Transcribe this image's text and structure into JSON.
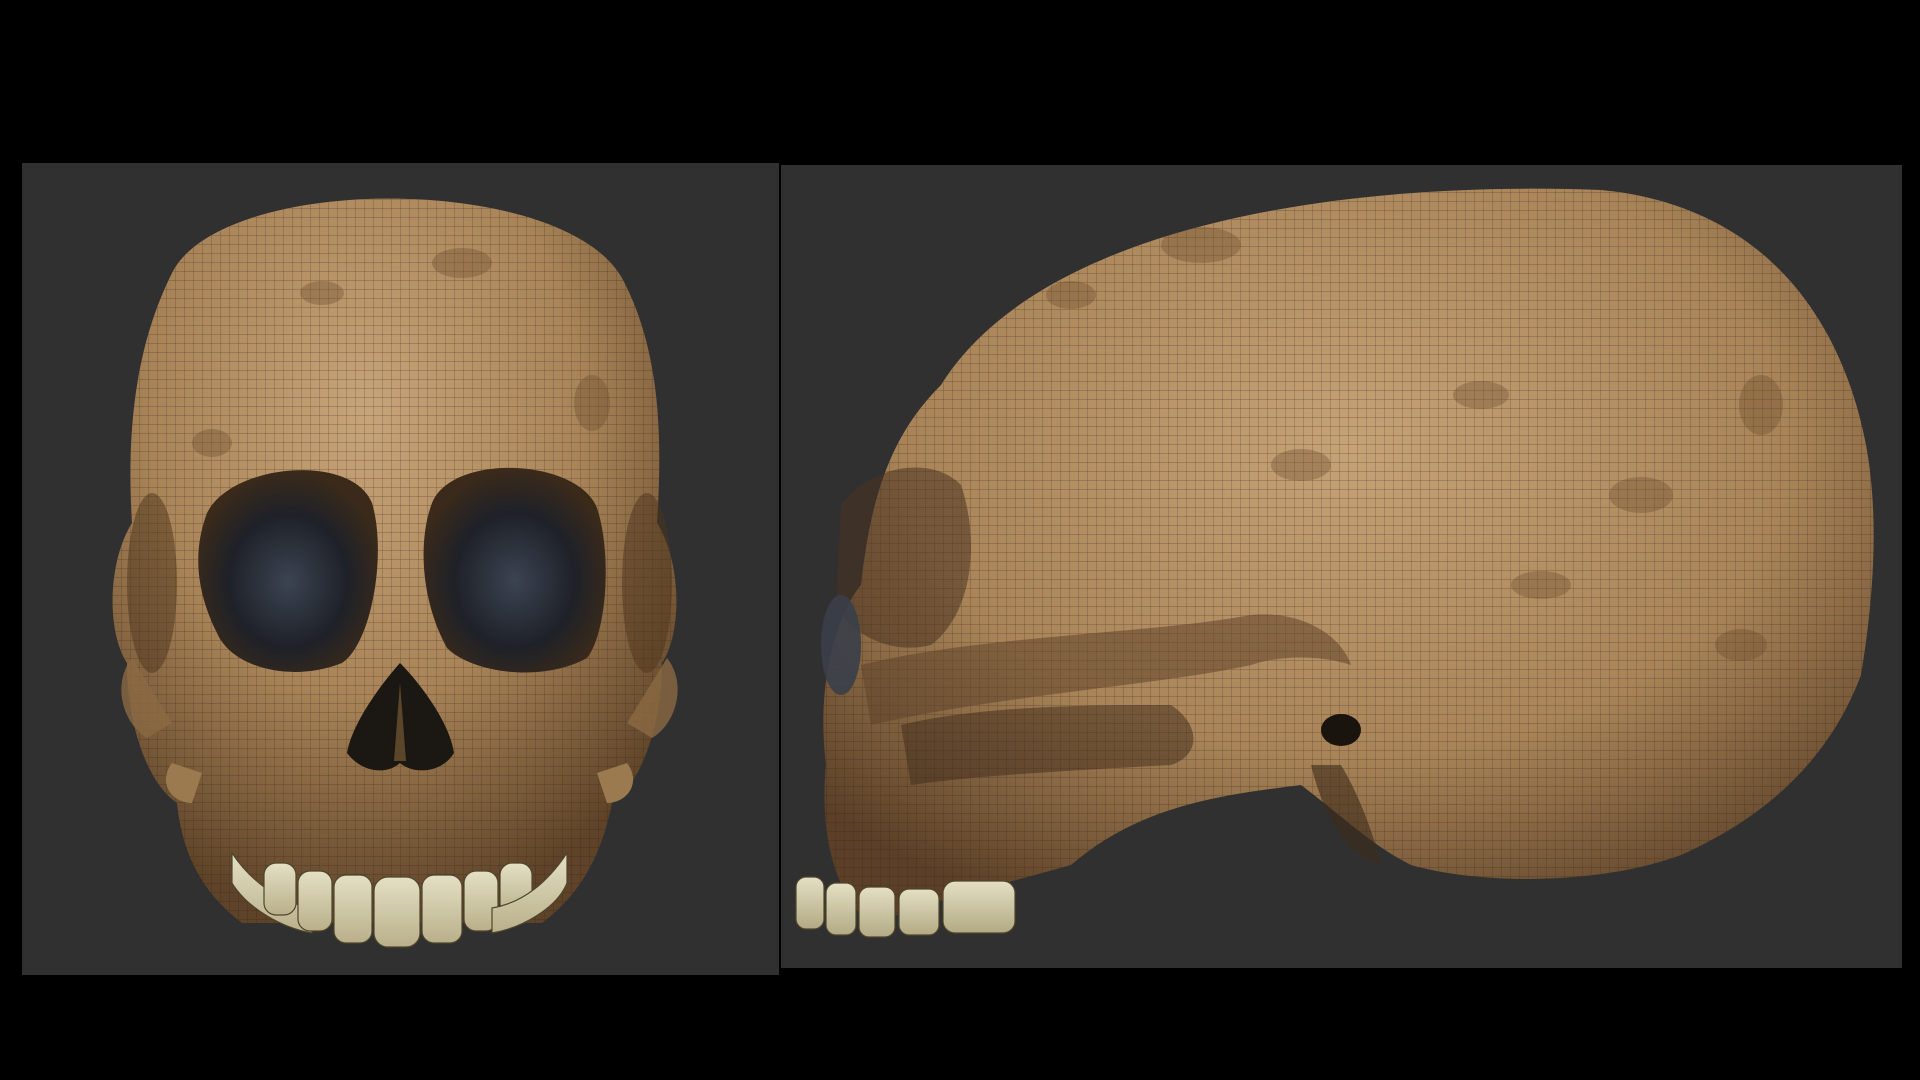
{
  "background_color": "#000000",
  "viewport_color": "#303030",
  "bone_color": "#a98458",
  "teeth_color": "#d8d3b2",
  "views": [
    {
      "name": "skull-front-view",
      "icon": "skull-front"
    },
    {
      "name": "skull-side-view",
      "icon": "skull-profile"
    }
  ]
}
